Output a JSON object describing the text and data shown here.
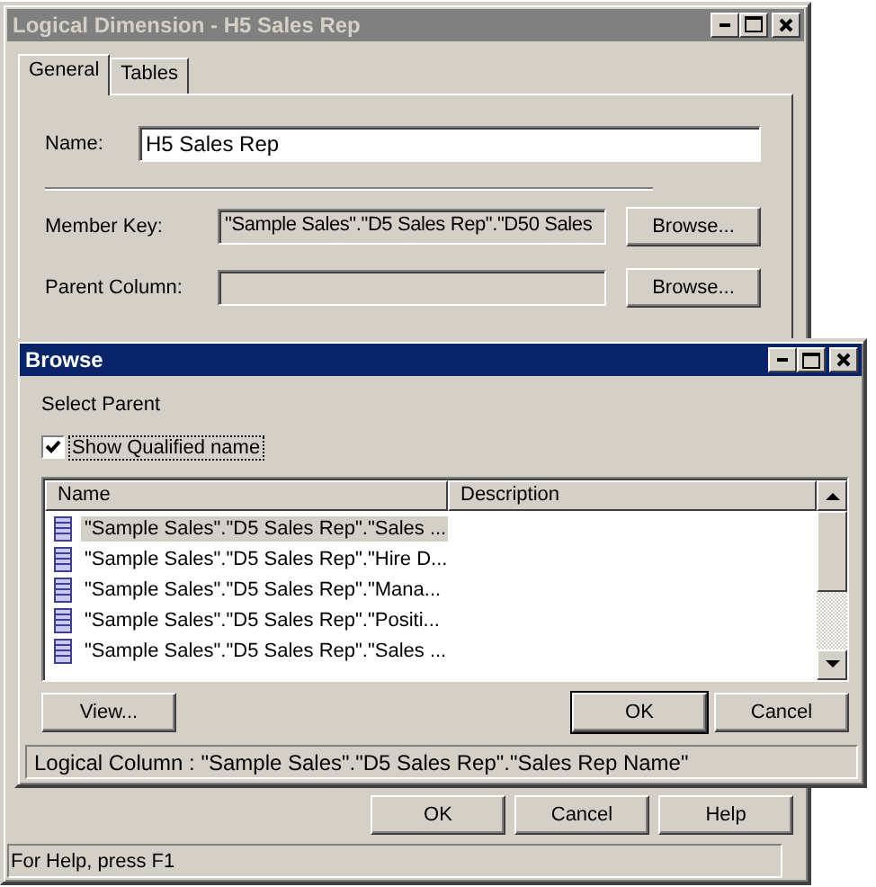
{
  "main_window": {
    "title": "Logical Dimension - H5 Sales Rep",
    "tabs": [
      {
        "label": "General",
        "selected": true
      },
      {
        "label": "Tables",
        "selected": false
      }
    ],
    "name_field": {
      "label": "Name:",
      "value": "H5 Sales Rep"
    },
    "member_key": {
      "label": "Member Key:",
      "value": "\"Sample Sales\".\"D5 Sales Rep\".\"D50 Sales",
      "button": "Browse..."
    },
    "parent_column": {
      "label": "Parent Column:",
      "button": "Browse..."
    },
    "buttons": [
      "OK",
      "Cancel",
      "Help"
    ],
    "status_bar": "For Help, press F1"
  },
  "browse_dialog": {
    "title": "Browse",
    "prompt": "Select Parent",
    "show_qualified": {
      "label": "Show Qualified name",
      "checked": true
    },
    "list": {
      "columns": [
        "Name",
        "Description"
      ],
      "rows": [
        {
          "name": "\"Sample Sales\".\"D5 Sales Rep\".\"Sales ...",
          "selected": true
        },
        {
          "name": "\"Sample Sales\".\"D5 Sales Rep\".\"Hire D...",
          "selected": false
        },
        {
          "name": "\"Sample Sales\".\"D5 Sales Rep\".\"Mana...",
          "selected": false
        },
        {
          "name": "\"Sample Sales\".\"D5 Sales Rep\".\"Positi...",
          "selected": false
        },
        {
          "name": "\"Sample Sales\".\"D5 Sales Rep\".\"Sales ...",
          "selected": false
        }
      ]
    },
    "view_button": "View...",
    "buttons": [
      {
        "label": "OK",
        "default": true
      },
      {
        "label": "Cancel",
        "default": false
      }
    ],
    "status": "Logical Column : \"Sample Sales\".\"D5 Sales Rep\".\"Sales Rep Name\""
  }
}
